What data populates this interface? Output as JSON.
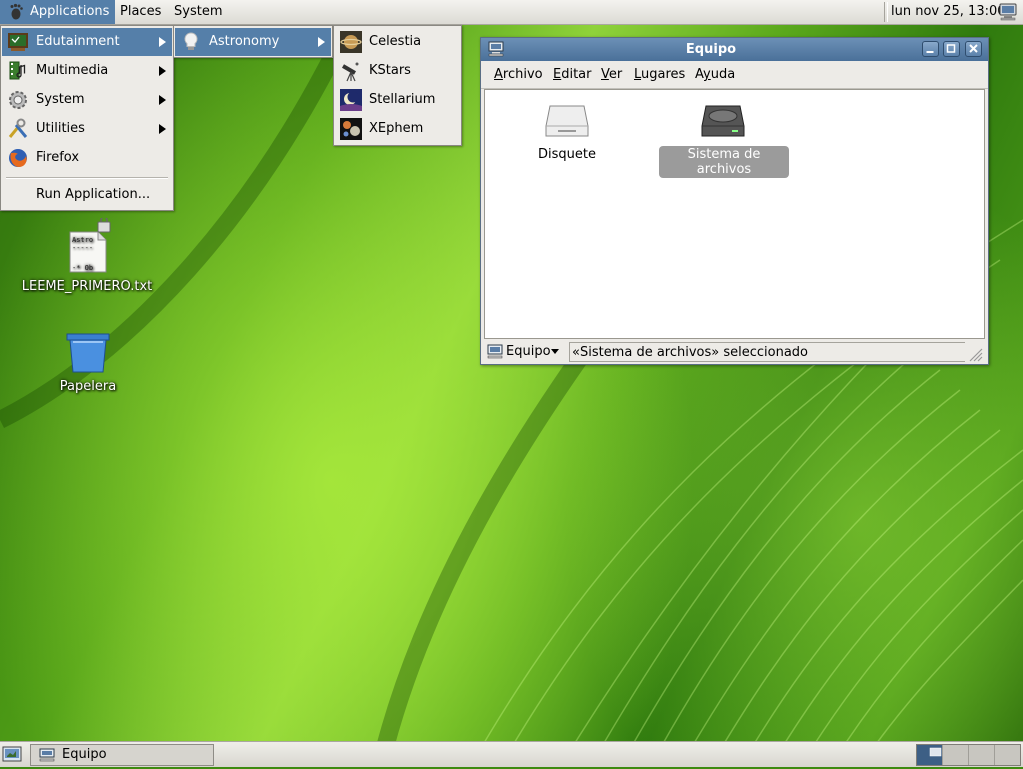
{
  "top_panel": {
    "applications": "Applications",
    "places": "Places",
    "system": "System",
    "clock": "lun nov 25, 13:00"
  },
  "applications_menu": {
    "items": [
      {
        "label": "Edutainment",
        "icon": "edutainment-icon",
        "submenu": true
      },
      {
        "label": "Multimedia",
        "icon": "multimedia-icon",
        "submenu": true
      },
      {
        "label": "System",
        "icon": "system-gear-icon",
        "submenu": true
      },
      {
        "label": "Utilities",
        "icon": "utilities-icon",
        "submenu": true
      },
      {
        "label": "Firefox",
        "icon": "firefox-icon",
        "submenu": false
      }
    ],
    "run_application": "Run Application..."
  },
  "edutainment_menu": {
    "items": [
      {
        "label": "Astronomy",
        "icon": "lightbulb-icon",
        "submenu": true
      }
    ]
  },
  "astronomy_menu": {
    "items": [
      {
        "label": "Celestia",
        "icon": "celestia-icon"
      },
      {
        "label": "KStars",
        "icon": "telescope-icon"
      },
      {
        "label": "Stellarium",
        "icon": "stellarium-icon"
      },
      {
        "label": "XEphem",
        "icon": "xephem-icon"
      }
    ]
  },
  "desktop": {
    "icons": [
      {
        "label": "LEEME_PRIMERO.txt",
        "icon": "text-file-icon",
        "file_text": [
          "Astro",
          "-----",
          "-* Ob"
        ]
      },
      {
        "label": "Papelera",
        "icon": "trash-icon"
      }
    ]
  },
  "window": {
    "title": "Equipo",
    "menubar": [
      {
        "key": "A",
        "rest": "rchivo"
      },
      {
        "key": "E",
        "rest": "ditar"
      },
      {
        "key": "V",
        "rest": "er"
      },
      {
        "key": "L",
        "rest": "ugares"
      },
      {
        "key": "Ay",
        "rest": "uda",
        "underline_index": 1
      }
    ],
    "items": [
      {
        "label": "Disquete",
        "icon": "floppy-drive-icon",
        "selected": false
      },
      {
        "label": "Sistema de archivos",
        "icon": "hard-disk-icon",
        "selected": true
      }
    ],
    "status_location": "Equipo",
    "status_text": "«Sistema de archivos» seleccionado"
  },
  "bottom_panel": {
    "task": "Equipo",
    "workspace_count": 4,
    "active_workspace": 1
  },
  "colors": {
    "selection": "#557fa9",
    "panel": "#e8e6e1",
    "titlebar": "#5a80a8"
  }
}
